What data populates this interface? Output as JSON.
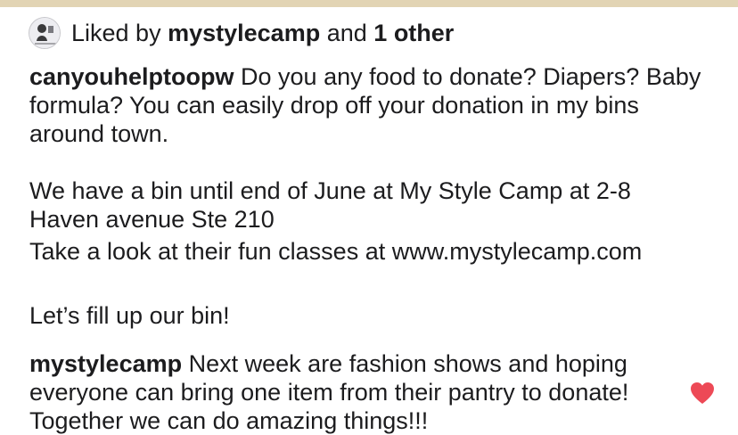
{
  "likes": {
    "prefix": "Liked by",
    "user": "mystylecamp",
    "connector": "and",
    "others": "1 other"
  },
  "post": {
    "username": "canyouhelptoopw",
    "text_1": "Do you any food to donate? Diapers? Baby formula? You can easily drop off your donation in my bins around town.",
    "text_2a": "We have a bin until end of June at My Style Camp at 2-8 Haven avenue Ste 210",
    "text_2b": "Take a look at their fun classes at www.mystylecamp.com",
    "text_3": "Let’s fill up our bin!"
  },
  "comment": {
    "username": "mystylecamp",
    "text": "Next week are fashion shows and hoping everyone can bring one item from their pantry to donate! Together we can do amazing things!!!",
    "liked": true
  },
  "colors": {
    "top_strip": "#e2d4b4",
    "heart": "#ed4956"
  },
  "icons": {
    "avatar": "avatar",
    "heart": "heart-icon"
  }
}
